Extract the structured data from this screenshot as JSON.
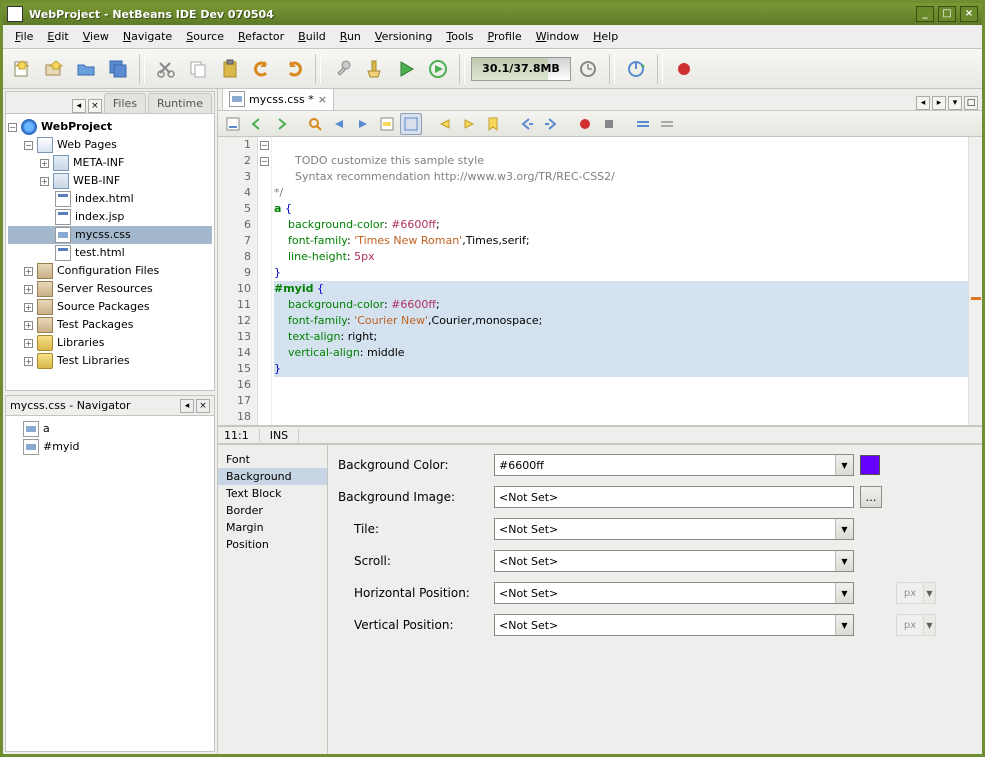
{
  "window": {
    "title": "WebProject - NetBeans IDE Dev 070504"
  },
  "menus": [
    "File",
    "Edit",
    "View",
    "Navigate",
    "Source",
    "Refactor",
    "Build",
    "Run",
    "Versioning",
    "Tools",
    "Profile",
    "Window",
    "Help"
  ],
  "memory": "30.1/37.8MB",
  "left": {
    "tabs": {
      "files": "Files",
      "runtime": "Runtime"
    },
    "project": "WebProject",
    "webpages": "Web Pages",
    "metainf": "META-INF",
    "webinf": "WEB-INF",
    "files": [
      "index.html",
      "index.jsp",
      "mycss.css",
      "test.html"
    ],
    "groups": [
      "Configuration Files",
      "Server Resources",
      "Source Packages",
      "Test Packages",
      "Libraries",
      "Test Libraries"
    ]
  },
  "navigator": {
    "title": "mycss.css - Navigator",
    "items": [
      "a",
      "#myid"
    ]
  },
  "editor": {
    "tab": "mycss.css *",
    "start_line": 1,
    "code": [
      {
        "n": 1,
        "t": ""
      },
      {
        "n": 2,
        "t": "      TODO customize this sample style",
        "cls": "c-comm"
      },
      {
        "n": 3,
        "t": "      Syntax recommendation http://www.w3.org/TR/REC-CSS2/",
        "cls": "c-comm"
      },
      {
        "n": 4,
        "t": "*/",
        "cls": "c-comm"
      },
      {
        "n": 5,
        "fold": true,
        "html": "<span class='c-sel'>a</span> <span class='c-brace'>{</span>"
      },
      {
        "n": 6,
        "html": "    <span class='c-prop'>background-color</span>: <span class='c-val'>#6600ff</span>;"
      },
      {
        "n": 7,
        "html": "    <span class='c-prop'>font-family</span>: <span class='c-str'>'Times New Roman'</span>,Times,serif;"
      },
      {
        "n": 8,
        "html": "    <span class='c-prop'>line-height</span>: <span class='c-val'>5px</span>"
      },
      {
        "n": 9,
        "html": "<span class='c-brace'>}</span>"
      },
      {
        "n": 10,
        "fold": true,
        "sel": true,
        "html": "<span class='c-sel'>#myid</span> <span class='c-brace'>{</span>"
      },
      {
        "n": 11,
        "hl": true,
        "sel": true,
        "html": "    <span class='c-prop'>background-color</span>: <span class='c-val'>#6600ff</span>;"
      },
      {
        "n": 12,
        "sel": true,
        "html": "    <span class='c-prop'>font-family</span>: <span class='c-str'>'Courier New'</span>,Courier,monospace;"
      },
      {
        "n": 13,
        "sel": true,
        "html": "    <span class='c-prop'>text-align</span>: right;"
      },
      {
        "n": 14,
        "sel": true,
        "html": "    <span class='c-prop'>vertical-align</span>: middle"
      },
      {
        "n": 15,
        "sel": true,
        "html": "<span class='c-brace'>}</span>"
      },
      {
        "n": 16,
        "t": ""
      },
      {
        "n": 17,
        "t": ""
      },
      {
        "n": 18,
        "t": ""
      }
    ],
    "cursor": "11:1",
    "ins": "INS"
  },
  "props": {
    "categories": [
      "Font",
      "Background",
      "Text Block",
      "Border",
      "Margin",
      "Position"
    ],
    "selected": "Background",
    "labels": {
      "bgcolor": "Background Color:",
      "bgimg": "Background Image:",
      "tile": "Tile:",
      "scroll": "Scroll:",
      "hpos": "Horizontal Position:",
      "vpos": "Vertical Position:"
    },
    "values": {
      "bgcolor": "#6600ff",
      "bgimg": "<Not Set>",
      "tile": "<Not Set>",
      "scroll": "<Not Set>",
      "hpos": "<Not Set>",
      "vpos": "<Not Set>",
      "unit": "px"
    }
  }
}
